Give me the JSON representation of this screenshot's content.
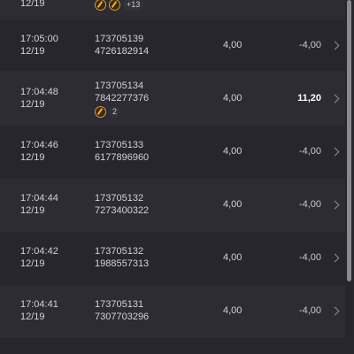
{
  "partial_row": {
    "date": "12/19",
    "extra_count": "+13"
  },
  "rows": [
    {
      "time": "17:05:00",
      "date": "12/19",
      "id_line1": "173705139",
      "id_line2": "4726182914",
      "bet": "4,00",
      "pnl": "-4,00"
    },
    {
      "time": "17:04:48",
      "date": "12/19",
      "id_line1": "173705134",
      "id_line2": "7842277376",
      "bet": "4,00",
      "pnl": "11,20",
      "badge_count": "2"
    },
    {
      "time": "17:04:46",
      "date": "12/19",
      "id_line1": "173705133",
      "id_line2": "6177896960",
      "bet": "4,00",
      "pnl": "-4,00"
    },
    {
      "time": "17:04:44",
      "date": "12/19",
      "id_line1": "173705132",
      "id_line2": "7273400322",
      "bet": "4,00",
      "pnl": "-4,00"
    },
    {
      "time": "17:04:42",
      "date": "12/19",
      "id_line1": "173705132",
      "id_line2": "1988557313",
      "bet": "4,00",
      "pnl": "-4,00"
    },
    {
      "time": "17:04:41",
      "date": "12/19",
      "id_line1": "173705131",
      "id_line2": "7307703296",
      "bet": "4,00",
      "pnl": "-4,00"
    }
  ],
  "icons": {
    "coin": "coin-icon",
    "chevron": "chevron-right-icon"
  }
}
